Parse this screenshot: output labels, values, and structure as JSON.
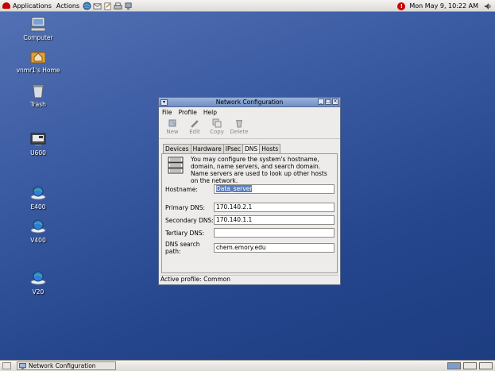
{
  "top_panel": {
    "applications": "Applications",
    "actions": "Actions",
    "clock": "Mon May  9, 10:22 AM",
    "launchers": [
      "globe-icon",
      "mail-icon",
      "edit-icon",
      "printer-icon",
      "network-icon"
    ]
  },
  "desktop": {
    "icons": [
      {
        "label": "Computer",
        "icon": "computer-icon"
      },
      {
        "label": "vnmr1's Home",
        "icon": "home-folder-icon"
      },
      {
        "label": "Trash",
        "icon": "trash-icon"
      },
      {
        "label": "U600",
        "icon": "instrument-icon"
      },
      {
        "label": "E400",
        "icon": "network-host-icon"
      },
      {
        "label": "V400",
        "icon": "network-host-icon"
      },
      {
        "label": "V20",
        "icon": "network-host-icon"
      }
    ]
  },
  "window": {
    "title": "Network Configuration",
    "menu": [
      "File",
      "Profile",
      "Help"
    ],
    "toolbar": [
      {
        "label": "New",
        "icon": "new-icon"
      },
      {
        "label": "Edit",
        "icon": "edit-icon"
      },
      {
        "label": "Copy",
        "icon": "copy-icon"
      },
      {
        "label": "Delete",
        "icon": "delete-icon"
      }
    ],
    "tabs": [
      "Devices",
      "Hardware",
      "IPsec",
      "DNS",
      "Hosts"
    ],
    "active_tab": "DNS",
    "info_text": "You may configure the system's hostname, domain, name servers, and search domain. Name servers are used to look up other hosts on the network.",
    "fields": [
      {
        "label": "Hostname:",
        "value": "Data_server"
      },
      {
        "label": "Primary DNS:",
        "value": "170.140.2.1"
      },
      {
        "label": "Secondary DNS:",
        "value": "170.140.1.1"
      },
      {
        "label": "Tertiary DNS:",
        "value": ""
      },
      {
        "label": "DNS search path:",
        "value": "chem.emory.edu"
      }
    ],
    "status": "Active profile: Common"
  },
  "bottom_panel": {
    "task_label": "Network Configuration"
  },
  "colors": {
    "desktop": "#2e4f97",
    "titlebar": "#7f9ccd",
    "selection": "#5a7ec1"
  }
}
